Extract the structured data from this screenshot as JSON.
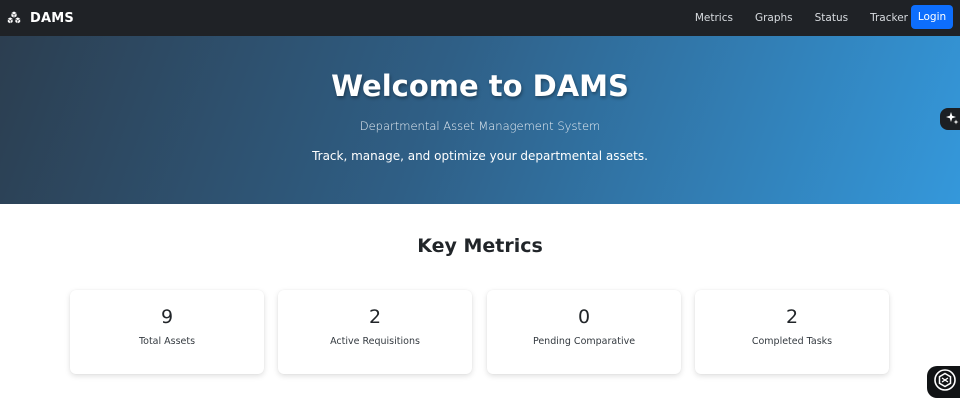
{
  "navbar": {
    "brand_icon": "cubes-icon",
    "brand": "DAMS",
    "links": [
      "Metrics",
      "Graphs",
      "Status",
      "Tracker"
    ],
    "login_label": "Login",
    "login_color": "#0d6efd",
    "background": "#1f2226"
  },
  "hero": {
    "title": "Welcome to DAMS",
    "subtitle": "Departmental Asset Management System",
    "tagline": "Track, manage, and optimize your departmental assets.",
    "gradient": [
      "#2c3e50",
      "#3498db"
    ],
    "side_tab_icon": "sparkle-icon"
  },
  "metrics": {
    "title": "Key Metrics",
    "cards": [
      {
        "value": "9",
        "label": "Total Assets"
      },
      {
        "value": "2",
        "label": "Active Requisitions"
      },
      {
        "value": "0",
        "label": "Pending Comparative"
      },
      {
        "value": "2",
        "label": "Completed Tasks"
      }
    ]
  },
  "floating_button": {
    "icon": "chat-assistant-icon"
  }
}
